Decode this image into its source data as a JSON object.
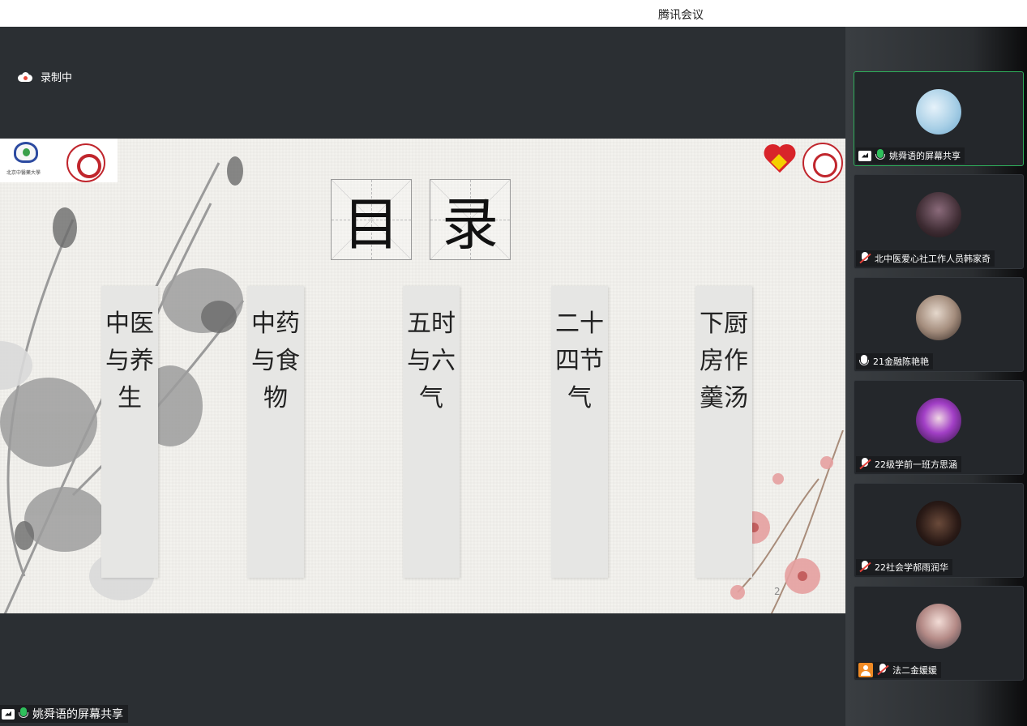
{
  "window": {
    "title": "腾讯会议"
  },
  "recording": {
    "label": "录制中",
    "icon": "cloud-record-icon"
  },
  "slide": {
    "heading": [
      "目",
      "录"
    ],
    "columns": [
      "中医与养生",
      "中药与食物",
      "五时与六气",
      "二十四节气",
      "下厨房作羹汤"
    ],
    "page_number": "2",
    "logo_text": "北京中醫藥大學"
  },
  "share_label": "姚舜语的屏幕共享",
  "participants": [
    {
      "name": "姚舜语的屏幕共享",
      "status": "sharing",
      "mic": "on"
    },
    {
      "name": "北中医爱心社工作人员韩家奇",
      "mic": "muted"
    },
    {
      "name": "21金融陈艳艳",
      "mic": "on"
    },
    {
      "name": "22级学前一班方思涵",
      "mic": "muted"
    },
    {
      "name": "22社会学郝雨润华",
      "mic": "muted"
    },
    {
      "name": "法二金媛媛",
      "mic": "muted",
      "badge": "user-icon"
    }
  ],
  "colors": {
    "active_border": "#2fae5b",
    "mic_on": "#2fc05c",
    "mic_off": "#e5413a",
    "badge": "#f08a24"
  }
}
